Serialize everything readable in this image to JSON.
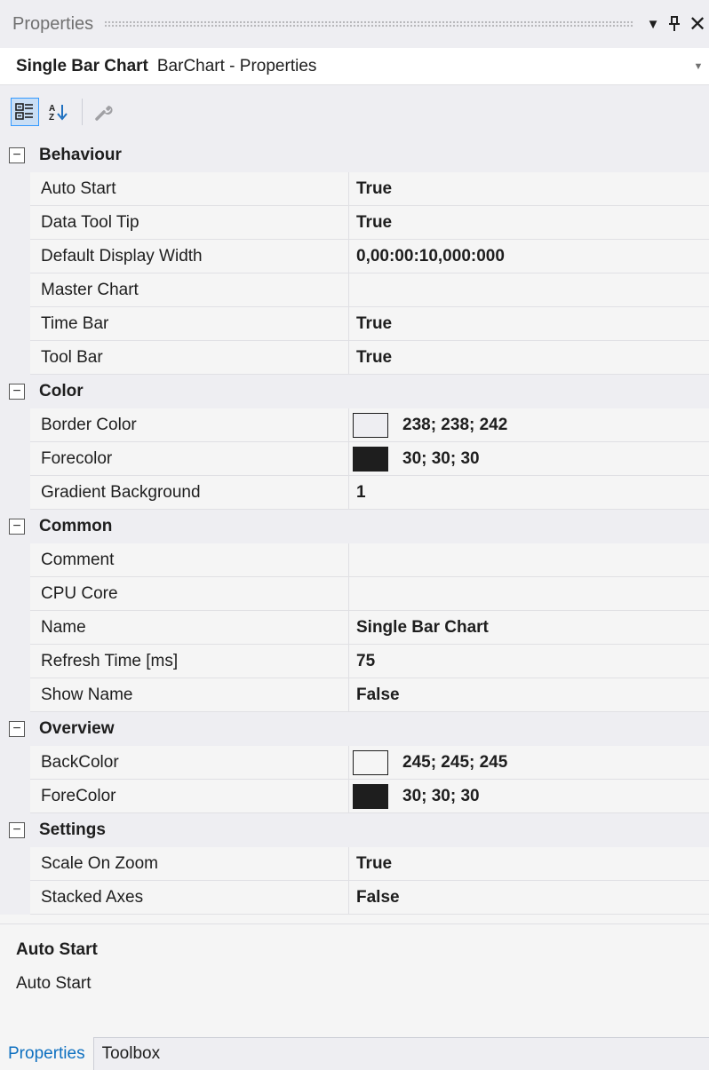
{
  "window": {
    "title": "Properties",
    "dropdown_icon": "▼",
    "pin_icon": "Ⅎ",
    "close_icon": "✕"
  },
  "object_selector": {
    "name": "Single Bar Chart",
    "type": "BarChart - Properties"
  },
  "toolbar": {
    "buttons": [
      "categorized-icon",
      "alphabetical-icon",
      "property-pages-icon"
    ]
  },
  "categories": [
    {
      "name": "Behaviour",
      "toggle": "−",
      "properties": [
        {
          "name": "Auto Start",
          "value": "True"
        },
        {
          "name": "Data Tool Tip",
          "value": "True"
        },
        {
          "name": "Default Display Width",
          "value": "0,00:00:10,000:000"
        },
        {
          "name": "Master Chart",
          "value": ""
        },
        {
          "name": "Time Bar",
          "value": "True"
        },
        {
          "name": "Tool Bar",
          "value": "True"
        }
      ]
    },
    {
      "name": "Color",
      "toggle": "−",
      "properties": [
        {
          "name": "Border Color",
          "value": "238; 238; 242",
          "swatch": "#eeeef2"
        },
        {
          "name": "Forecolor",
          "value": "30; 30; 30",
          "swatch": "#1e1e1e"
        },
        {
          "name": "Gradient Background",
          "value": "1"
        }
      ]
    },
    {
      "name": "Common",
      "toggle": "−",
      "properties": [
        {
          "name": "Comment",
          "value": ""
        },
        {
          "name": "CPU Core",
          "value": ""
        },
        {
          "name": "Name",
          "value": "Single Bar Chart"
        },
        {
          "name": "Refresh Time [ms]",
          "value": "75"
        },
        {
          "name": "Show Name",
          "value": "False"
        }
      ]
    },
    {
      "name": "Overview",
      "toggle": "−",
      "properties": [
        {
          "name": "BackColor",
          "value": "245; 245; 245",
          "swatch": "#f5f5f5"
        },
        {
          "name": "ForeColor",
          "value": "30; 30; 30",
          "swatch": "#1e1e1e"
        }
      ]
    },
    {
      "name": "Settings",
      "toggle": "−",
      "properties": [
        {
          "name": "Scale On Zoom",
          "value": "True"
        },
        {
          "name": "Stacked Axes",
          "value": "False"
        }
      ]
    }
  ],
  "description": {
    "title": "Auto Start",
    "text": "Auto Start"
  },
  "tabs": [
    {
      "label": "Properties",
      "active": true
    },
    {
      "label": "Toolbox",
      "active": false
    }
  ],
  "colors": {
    "background": "#f5f5f5",
    "chrome": "#eeeef2",
    "accent": "#0e70c0"
  }
}
